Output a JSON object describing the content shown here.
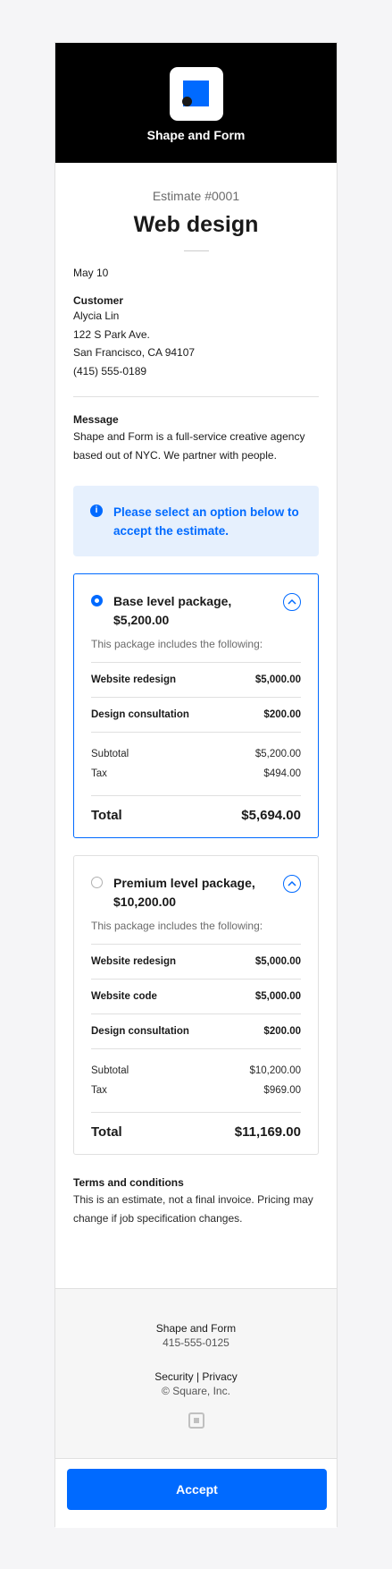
{
  "brand": {
    "name": "Shape and Form",
    "accent": "#006aff"
  },
  "estimate": {
    "number": "Estimate #0001",
    "title": "Web design",
    "date": "May 10"
  },
  "customer": {
    "label": "Customer",
    "lines": [
      "Alycia Lin",
      "122 S Park Ave.",
      "San Francisco, CA 94107",
      "(415) 555-0189"
    ]
  },
  "message": {
    "label": "Message",
    "body": "Shape and Form is a full-service creative agency based out of NYC. We partner with people."
  },
  "notice": "Please select an option below to accept the estimate.",
  "packages": [
    {
      "title": "Base level package, $5,200.00",
      "selected": true,
      "description": "This package includes the following:",
      "items": [
        {
          "name": "Website redesign",
          "price": "$5,000.00"
        },
        {
          "name": "Design consultation",
          "price": "$200.00"
        }
      ],
      "subtotal_label": "Subtotal",
      "subtotal": "$5,200.00",
      "tax_label": "Tax",
      "tax": "$494.00",
      "total_label": "Total",
      "total": "$5,694.00"
    },
    {
      "title": "Premium level package, $10,200.00",
      "selected": false,
      "description": "This package includes the following:",
      "items": [
        {
          "name": "Website redesign",
          "price": "$5,000.00"
        },
        {
          "name": "Website code",
          "price": "$5,000.00"
        },
        {
          "name": "Design consultation",
          "price": "$200.00"
        }
      ],
      "subtotal_label": "Subtotal",
      "subtotal": "$10,200.00",
      "tax_label": "Tax",
      "tax": "$969.00",
      "total_label": "Total",
      "total": "$11,169.00"
    }
  ],
  "terms": {
    "label": "Terms and conditions",
    "body": "This is an estimate, not a final invoice. Pricing may change if job specification changes."
  },
  "footer": {
    "name": "Shape and Form",
    "phone": "415-555-0125",
    "security": "Security",
    "separator": "|",
    "privacy": "Privacy",
    "copyright": "© Square, Inc."
  },
  "accept_label": "Accept"
}
